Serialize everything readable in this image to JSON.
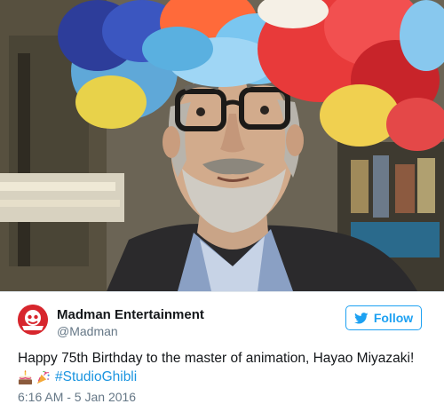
{
  "tweet": {
    "author_name": "Madman Entertainment",
    "author_handle": "@Madman",
    "follow_label": "Follow",
    "text": "Happy 75th Birthday to the master of animation, Hayao Miyazaki!",
    "hashtag": "#StudioGhibli",
    "emojis": [
      "birthday-cake-icon",
      "party-popper-icon"
    ],
    "timestamp": "6:16 AM - 5 Jan 2016"
  },
  "colors": {
    "accent": "#1da1f2",
    "hashtag": "#1b95e0",
    "avatar_bg": "#d7262d",
    "text": "#14171a",
    "muted": "#657786"
  }
}
